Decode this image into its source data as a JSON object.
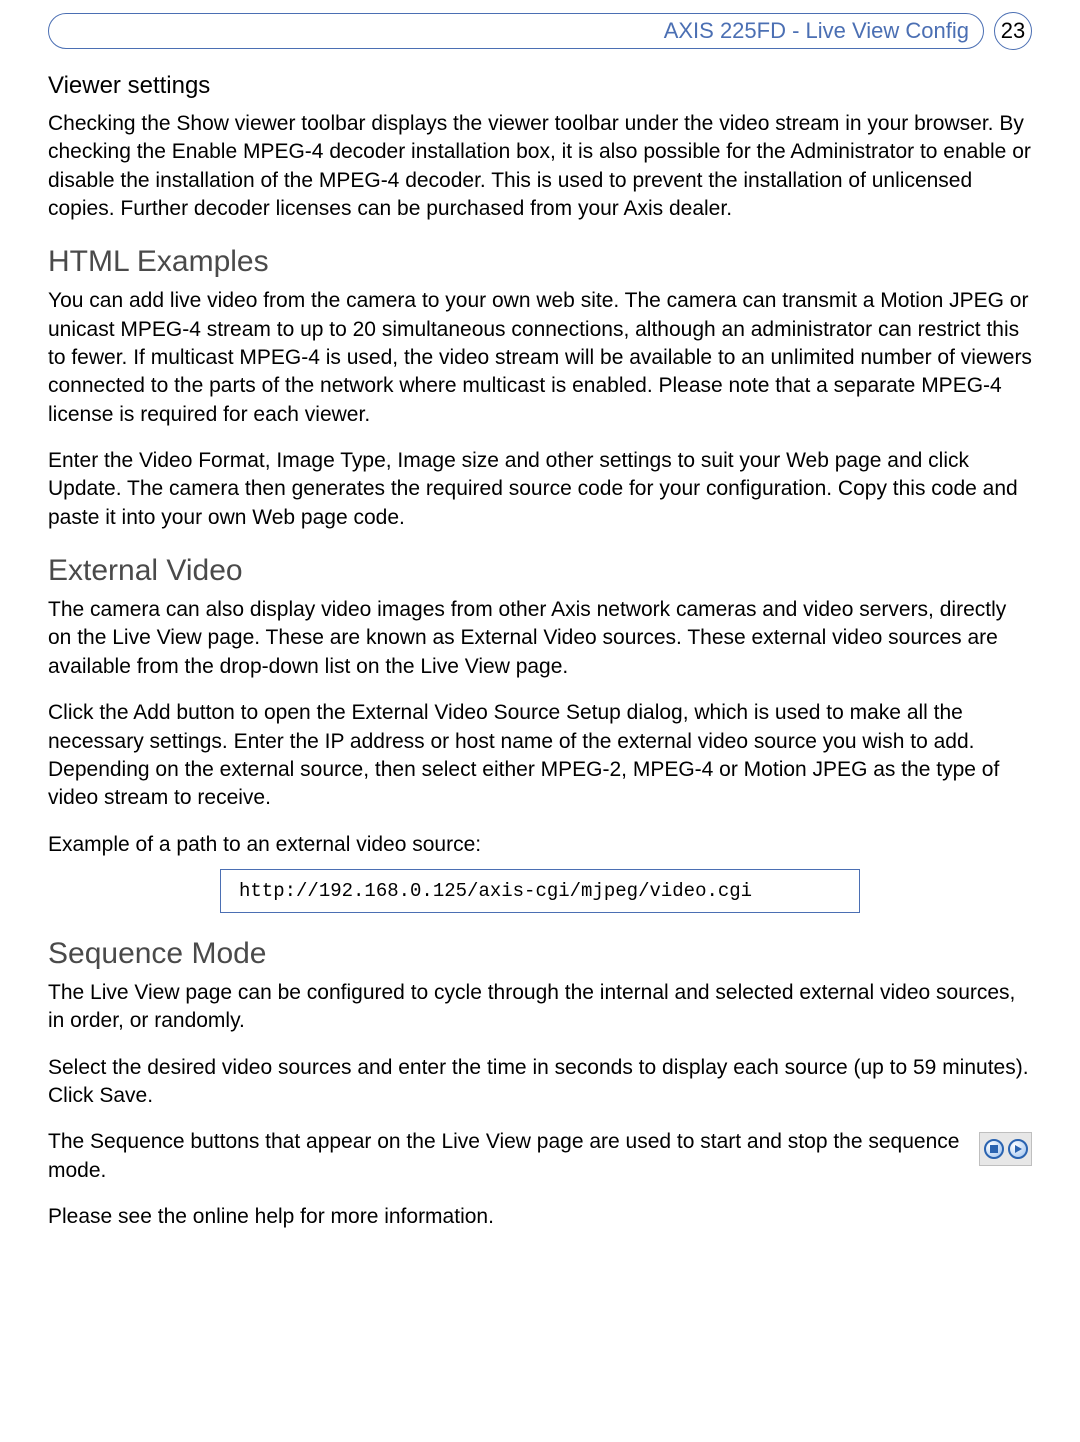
{
  "header": {
    "breadcrumb": "AXIS 225FD - Live View Config",
    "page_number": "23"
  },
  "sections": {
    "viewer": {
      "heading": "Viewer settings",
      "p1": "Checking the Show viewer toolbar displays the viewer toolbar under the video stream in your browser. By checking the Enable MPEG-4 decoder installation box, it is also possible for the Administrator to enable or disable the installation of the MPEG-4 decoder. This is used to prevent the installation of unlicensed copies. Further decoder licenses can be purchased from your Axis dealer."
    },
    "html_examples": {
      "heading": "HTML Examples",
      "p1": "You can add live video from the camera to your own web site. The camera can transmit a Motion JPEG or unicast MPEG-4 stream to up to 20 simultaneous connections, although an administrator can restrict this to fewer. If multicast MPEG-4 is used, the video stream will be available to an unlimited number of viewers connected to the parts of the network where multicast is enabled. Please note that a separate MPEG-4 license is required for each viewer.",
      "p2": "Enter the Video Format, Image Type, Image size and other settings to suit your Web page and click Update. The camera then generates the required source code for your configuration. Copy this code and paste it into your own Web page code."
    },
    "external_video": {
      "heading": "External Video",
      "p1": "The camera can also display video images from other Axis network cameras and video servers, directly on the Live View page. These are known as External Video sources. These external video sources are available from the drop-down list on the Live View page.",
      "p2": "Click the Add button to open the External Video Source Setup dialog, which is used to make all the necessary settings. Enter the IP address or host name of the external video source you wish to add. Depending on the external source, then select either MPEG-2, MPEG-4 or Motion JPEG as the type of video stream to receive.",
      "p3": "Example of a path to an external video source:",
      "code": "http://192.168.0.125/axis-cgi/mjpeg/video.cgi"
    },
    "sequence_mode": {
      "heading": "Sequence Mode",
      "p1": "The Live View page can be configured to cycle through the internal and selected external video sources, in order, or randomly.",
      "p2": "Select the desired video sources and enter the time in seconds to display each source (up to 59 minutes). Click Save.",
      "p3": "The Sequence buttons that appear on the Live View page are used to start and stop the sequence mode.",
      "p4": "Please see the online help for more information."
    }
  }
}
